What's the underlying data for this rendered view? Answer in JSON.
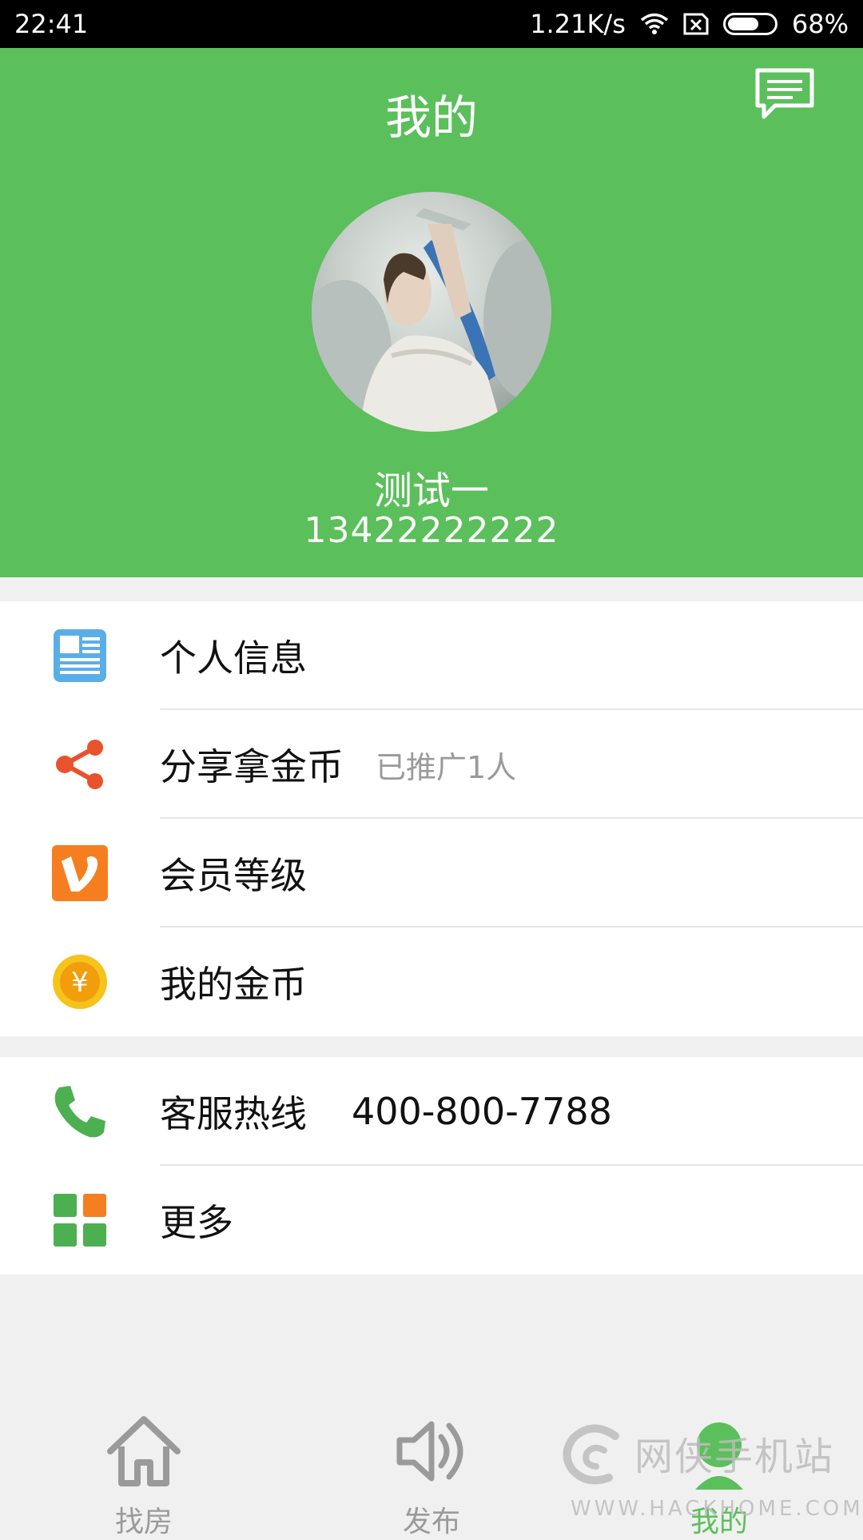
{
  "status_bar": {
    "time": "22:41",
    "net_speed": "1.21K/s",
    "battery": "68%",
    "battery_level": 0.68,
    "icons": [
      "wifi-icon",
      "no-sim-icon",
      "battery-icon"
    ]
  },
  "header": {
    "title": "我的",
    "message_icon": "message-icon",
    "user_name": "测试一",
    "phone": "13422222222",
    "bg_color": "#5bbf5b"
  },
  "menu": {
    "group1": [
      {
        "label": "个人信息",
        "icon": "profile-card-icon"
      },
      {
        "label": "分享拿金币",
        "sub": "已推广1人",
        "icon": "share-icon"
      },
      {
        "label": "会员等级",
        "icon": "vip-icon"
      },
      {
        "label": "我的金币",
        "icon": "coin-icon"
      }
    ],
    "group2": [
      {
        "label": "客服热线",
        "value": "400-800-7788",
        "icon": "phone-icon"
      },
      {
        "label": "更多",
        "icon": "grid-more-icon"
      }
    ]
  },
  "tabs": [
    {
      "label": "找房",
      "icon": "home-icon",
      "active": false
    },
    {
      "label": "发布",
      "icon": "speaker-icon",
      "active": false
    },
    {
      "label": "我的",
      "icon": "profile-dot-icon",
      "active": true
    }
  ],
  "watermark": {
    "text": "网侠手机站",
    "url": "WWW.HACKHOME.COM"
  }
}
